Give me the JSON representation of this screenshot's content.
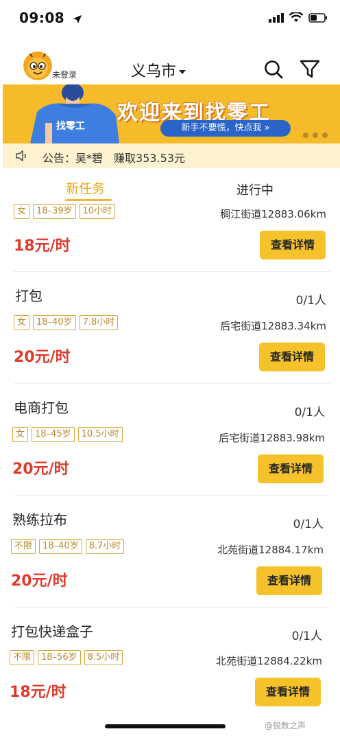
{
  "status_bar": {
    "time": "09:08",
    "icons": [
      "location-arrow-icon",
      "signal-icon",
      "wifi-icon",
      "battery-icon"
    ]
  },
  "header": {
    "login_label": "未登录",
    "city": "义乌市",
    "icons": [
      "avatar",
      "dropdown-caret-icon",
      "search-icon",
      "filter-icon"
    ]
  },
  "banner": {
    "title": "欢迎来到找零工",
    "cta": "新手不要慌，快点我 »",
    "shirt_text": "找零工",
    "colors": {
      "background": "#f6bb2a",
      "cta": "#2a64c9"
    }
  },
  "notice": {
    "label": "公告：吴*碧",
    "text": "赚取353.53元"
  },
  "tabs": {
    "new": "新任务",
    "ongoing": "进行中"
  },
  "detail_label": "查看详情",
  "jobs": [
    {
      "title": "",
      "count": "",
      "tags": [
        "女",
        "18–39岁",
        "10小时"
      ],
      "location": "稠江街道12883.06km",
      "wage": "18元/时"
    },
    {
      "title": "打包",
      "count": "0/1人",
      "tags": [
        "女",
        "18–40岁",
        "7.8小时"
      ],
      "location": "后宅街道12883.34km",
      "wage": "20元/时"
    },
    {
      "title": "电商打包",
      "count": "0/1人",
      "tags": [
        "女",
        "18–45岁",
        "10.5小时"
      ],
      "location": "后宅街道12883.98km",
      "wage": "20元/时"
    },
    {
      "title": "熟练拉布",
      "count": "0/1人",
      "tags": [
        "不限",
        "18–40岁",
        "8.7小时"
      ],
      "location": "北苑街道12884.17km",
      "wage": "20元/时"
    },
    {
      "title": "打包快递盒子",
      "count": "0/1人",
      "tags": [
        "不限",
        "18–56岁",
        "8.5小时"
      ],
      "location": "北苑街道12884.22km",
      "wage": "18元/时"
    }
  ],
  "watermark": "@锐数之声"
}
